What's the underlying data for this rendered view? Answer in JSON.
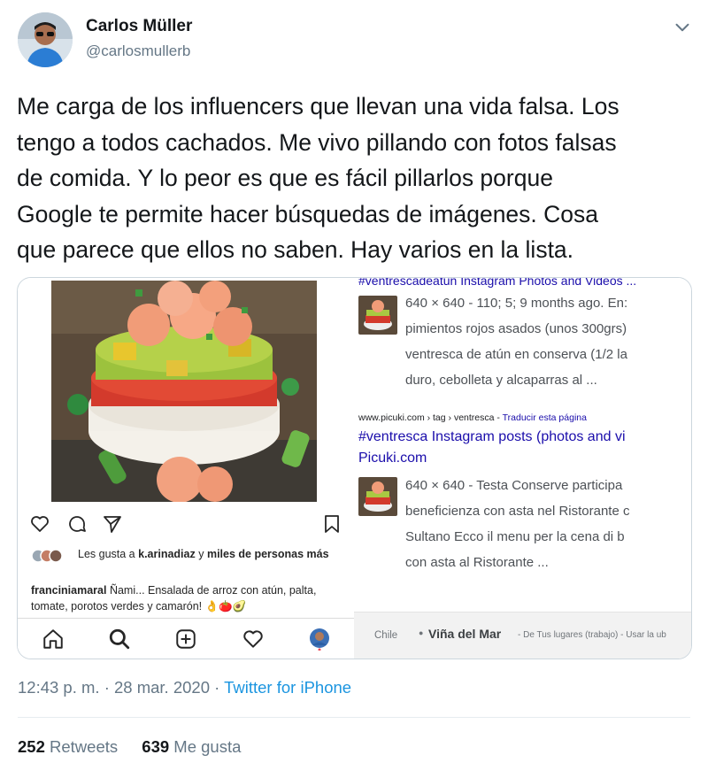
{
  "author": {
    "name": "Carlos Müller",
    "handle": "@carlosmullerb"
  },
  "tweet": {
    "text": "Me carga de los influencers que llevan una vida falsa. Los\ntengo a todos cachados. Me vivo pillando con fotos falsas\nde comida. Y lo peor es que es fácil pillarlos porque\nGoogle te permite hacer búsquedas de imágenes. Cosa\nque parece que ellos no saben. Hay varios en la lista."
  },
  "instagram": {
    "likes_prefix": "Les gusta a",
    "likes_user": "k.arinadiaz",
    "likes_mid": "y",
    "likes_rest": "miles de personas más",
    "caption_user": "franciniamaral",
    "caption_text": "Ñami... Ensalada de arroz con atún, palta, tomate, porotos verdes y camarón! 👌🍅🥑"
  },
  "google": {
    "top_cut_title": "#ventrescadeatun Instagram Photos and Videos ...",
    "result1": {
      "snippet": [
        "640 × 640 - 110; 5; 9 months ago. En:",
        "pimientos rojos asados (unos 300grs)",
        "ventresca de atún en conserva (1/2 la",
        "duro, cebolleta y alcaparras al  ..."
      ]
    },
    "result2": {
      "url": "www.picuki.com › tag › ventresca",
      "translate": "Traducir esta página",
      "title1": "#ventresca Instagram posts (photos and vi",
      "title2": "Picuki.com",
      "snippet": [
        "640 × 640 - Testa Conserve participa",
        "beneficienza con asta nel Ristorante c",
        "Sultano Ecco il menu per la cena di b",
        "con asta al Ristorante ..."
      ]
    },
    "footer": {
      "country": "Chile",
      "location": "Viña del Mar",
      "detail": "- De Tus lugares (trabajo) - Usar la ub"
    }
  },
  "meta": {
    "time": "12:43 p. m. · 28 mar. 2020 ·",
    "source": "Twitter for iPhone"
  },
  "stats": {
    "retweets": "252",
    "retweets_label": "Retweets",
    "likes": "639",
    "likes_label": "Me gusta"
  },
  "colors": {
    "link": "#1b95e0",
    "google_link": "#1a0dab",
    "secondary": "#657786"
  }
}
